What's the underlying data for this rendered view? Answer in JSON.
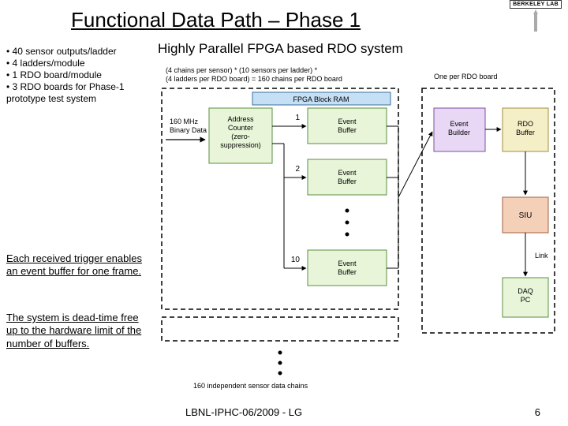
{
  "title": "Functional Data Path – Phase 1",
  "subtitle": "Highly Parallel FPGA based RDO system",
  "logo": {
    "label": "BERKELEY LAB"
  },
  "bullets": [
    "• 40 sensor outputs/ladder",
    "• 4 ladders/module",
    "• 1 RDO board/module",
    "• 3 RDO boards for Phase-1",
    "prototype test system"
  ],
  "notes": {
    "note1": "Each received trigger enables an event buffer for one frame.",
    "note2": "The system is dead-time free up to the hardware limit of the number of buffers."
  },
  "footer": {
    "left": "LBNL-IPHC-06/2009 - LG",
    "page": "6"
  },
  "diagram": {
    "top_left": "(4 chains per sensor) * (10 sensors per ladder) *\n(4 ladders per RDO board) = 160 chains per RDO board",
    "top_right": "One per RDO board",
    "fpga_header": "FPGA Block RAM",
    "input_rate": "160 MHz\nBinary Data",
    "addr_counter": "Address\nCounter\n(zero-\nsuppression)",
    "event_buffer": "Event\nBuffer",
    "nums": [
      "1",
      "2",
      "10"
    ],
    "event_builder": "Event\nBuilder",
    "rdo_buffer": "RDO\nBuffer",
    "siu": "SIU",
    "daq_pc": "DAQ\nPC",
    "link": "Link",
    "bottom_note": "160 independent sensor data chains"
  }
}
